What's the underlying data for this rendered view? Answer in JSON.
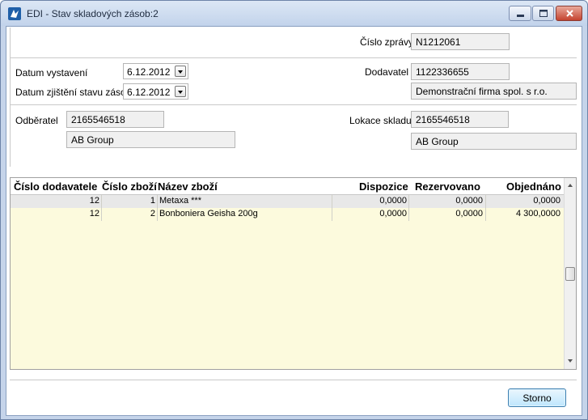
{
  "window": {
    "title": "EDI - Stav skladových zásob:2"
  },
  "form": {
    "cislo_zpravy": {
      "label": "Číslo zprávy",
      "value": "N1212061"
    },
    "datum_vystaveni": {
      "label": "Datum vystavení",
      "value": "6.12.2012"
    },
    "datum_zjisteni": {
      "label": "Datum zjištění stavu zásob",
      "value": "6.12.2012"
    },
    "dodavatel": {
      "label": "Dodavatel",
      "code": "1122336655",
      "name": "Demonstrační firma spol. s r.o."
    },
    "odberatel": {
      "label": "Odběratel",
      "code": "2165546518",
      "name": "AB Group"
    },
    "lokace_skladu": {
      "label": "Lokace skladu",
      "code": "2165546518",
      "name": "AB Group"
    }
  },
  "grid": {
    "columns": [
      "Číslo dodavatele",
      "Číslo zboží",
      "Název zboží",
      "Dispozice",
      "Rezervovano",
      "Objednáno"
    ],
    "rows": [
      [
        "12",
        "1",
        "Metaxa ***",
        "0,0000",
        "0,0000",
        "0,0000"
      ],
      [
        "12",
        "2",
        "Bonboniera Geisha 200g",
        "0,0000",
        "0,0000",
        "4 300,0000"
      ]
    ]
  },
  "buttons": {
    "storno": "Storno"
  },
  "colors": {
    "grid_background": "#fcfadd",
    "selected_row": "#e8e8e8",
    "titlebar": "#c2d3eb"
  }
}
